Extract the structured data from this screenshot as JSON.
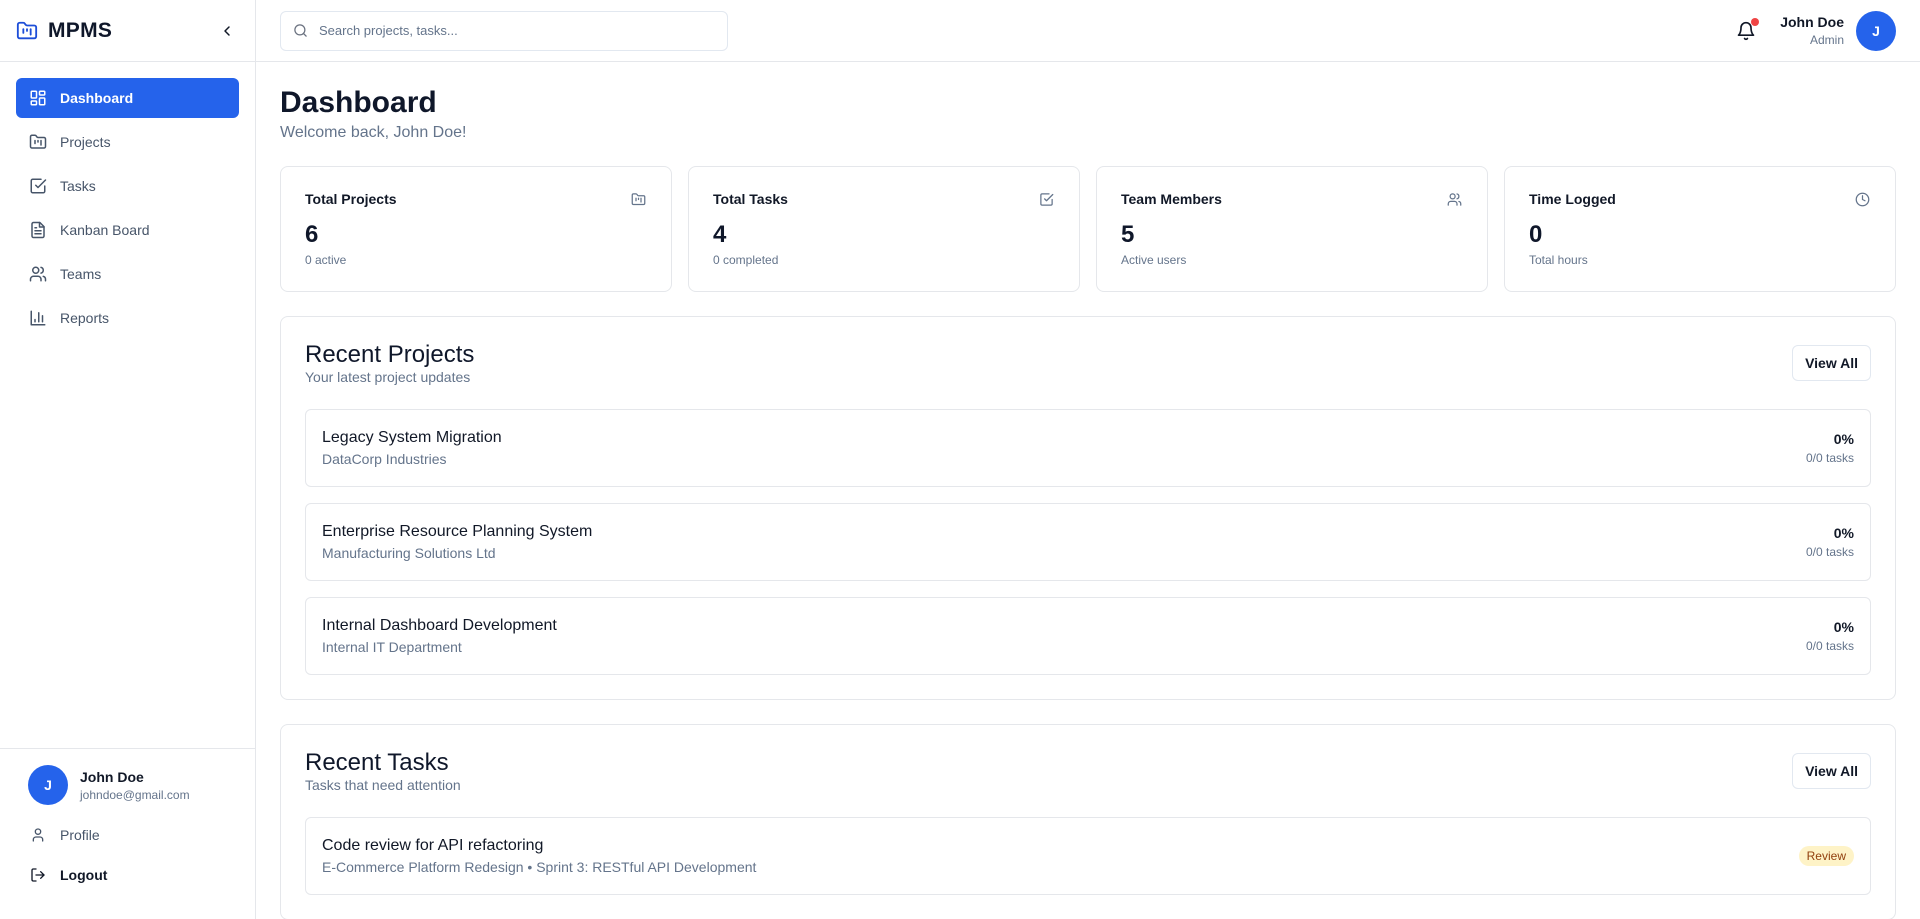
{
  "brand": {
    "name": "MPMS",
    "icon": "folder-kanban-icon"
  },
  "sidebar": {
    "items": [
      {
        "label": "Dashboard",
        "icon": "layout-dashboard-icon",
        "active": true
      },
      {
        "label": "Projects",
        "icon": "folder-kanban-icon"
      },
      {
        "label": "Tasks",
        "icon": "check-square-icon"
      },
      {
        "label": "Kanban Board",
        "icon": "file-text-icon"
      },
      {
        "label": "Teams",
        "icon": "users-icon"
      },
      {
        "label": "Reports",
        "icon": "bar-chart-icon"
      }
    ],
    "user": {
      "initial": "J",
      "name": "John Doe",
      "email": "johndoe@gmail.com"
    },
    "profile_label": "Profile",
    "logout_label": "Logout"
  },
  "header": {
    "search_placeholder": "Search projects, tasks...",
    "user": {
      "name": "John Doe",
      "role": "Admin",
      "initial": "J"
    },
    "has_notification": true
  },
  "page": {
    "title": "Dashboard",
    "subtitle": "Welcome back, John Doe!"
  },
  "stats": [
    {
      "label": "Total Projects",
      "value": "6",
      "sub": "0 active",
      "icon": "folder-kanban-icon"
    },
    {
      "label": "Total Tasks",
      "value": "4",
      "sub": "0 completed",
      "icon": "check-square-icon"
    },
    {
      "label": "Team Members",
      "value": "5",
      "sub": "Active users",
      "icon": "users-icon"
    },
    {
      "label": "Time Logged",
      "value": "0",
      "sub": "Total hours",
      "icon": "clock-icon"
    }
  ],
  "recent_projects": {
    "title": "Recent Projects",
    "subtitle": "Your latest project updates",
    "view_all": "View All",
    "items": [
      {
        "name": "Legacy System Migration",
        "client": "DataCorp Industries",
        "progress": "0%",
        "tasks": "0/0 tasks"
      },
      {
        "name": "Enterprise Resource Planning System",
        "client": "Manufacturing Solutions Ltd",
        "progress": "0%",
        "tasks": "0/0 tasks"
      },
      {
        "name": "Internal Dashboard Development",
        "client": "Internal IT Department",
        "progress": "0%",
        "tasks": "0/0 tasks"
      }
    ]
  },
  "recent_tasks": {
    "title": "Recent Tasks",
    "subtitle": "Tasks that need attention",
    "view_all": "View All",
    "items": [
      {
        "name": "Code review for API refactoring",
        "context": "E-Commerce Platform Redesign • Sprint 3: RESTful API Development",
        "status": "Review"
      }
    ]
  },
  "colors": {
    "primary": "#2563eb",
    "notification": "#ef4444",
    "review_badge_bg": "#fef3c7",
    "review_badge_text": "#92400e"
  }
}
